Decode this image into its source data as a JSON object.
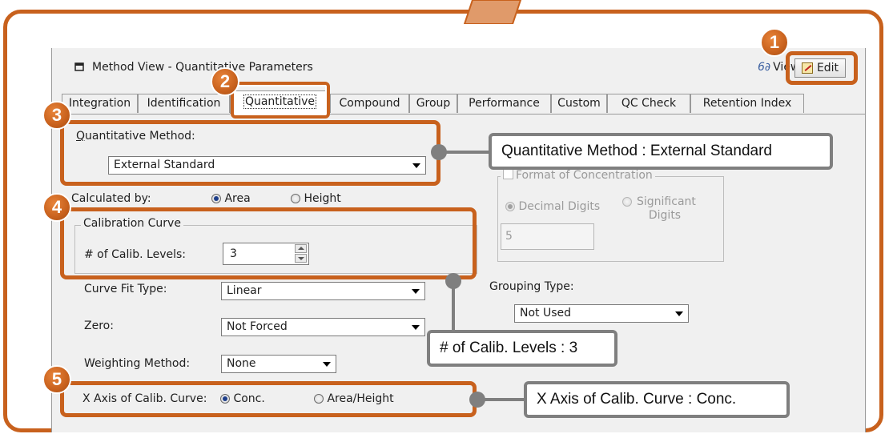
{
  "window": {
    "title": "Method View - Quantitative Parameters",
    "view_label": "View",
    "edit_label": "Edit"
  },
  "tabs": [
    {
      "label": "Integration"
    },
    {
      "label": "Identification"
    },
    {
      "label": "Quantitative",
      "active": true
    },
    {
      "label": "Compound"
    },
    {
      "label": "Group"
    },
    {
      "label": "Performance"
    },
    {
      "label": "Custom"
    },
    {
      "label": "QC Check"
    },
    {
      "label": "Retention Index"
    }
  ],
  "form": {
    "quant_method_label": "Quantitative Method:",
    "quant_method_value": "External Standard",
    "calculated_by_label": "Calculated by:",
    "area_label": "Area",
    "height_label": "Height",
    "calculated_by_selected": "Area",
    "calibration_group_label": "Calibration Curve",
    "calib_levels_label": "# of Calib. Levels:",
    "calib_levels_value": "3",
    "curve_fit_label": "Curve Fit Type:",
    "curve_fit_value": "Linear",
    "zero_label": "Zero:",
    "zero_value": "Not Forced",
    "weighting_label": "Weighting Method:",
    "weighting_value": "None",
    "x_axis_label": "X Axis of Calib. Curve:",
    "x_axis_conc": "Conc.",
    "x_axis_area_height": "Area/Height",
    "x_axis_selected": "Conc.",
    "format_group_label": "Format of Concentration",
    "decimal_digits_label": "Decimal Digits",
    "significant_digits_label": "Significant Digits",
    "digits_value": "5",
    "grouping_type_label": "Grouping Type:",
    "grouping_type_value": "Not Used"
  },
  "badges": [
    "1",
    "2",
    "3",
    "4",
    "5"
  ],
  "callouts": {
    "quant_method": "Quantitative Method : External Standard",
    "calib_levels": "# of Calib. Levels : 3",
    "x_axis": "X Axis of Calib. Curve : Conc."
  },
  "colors": {
    "highlight": "#c8611d",
    "callout_border": "#7f7f7f",
    "window_bg": "#f0f0f0"
  }
}
